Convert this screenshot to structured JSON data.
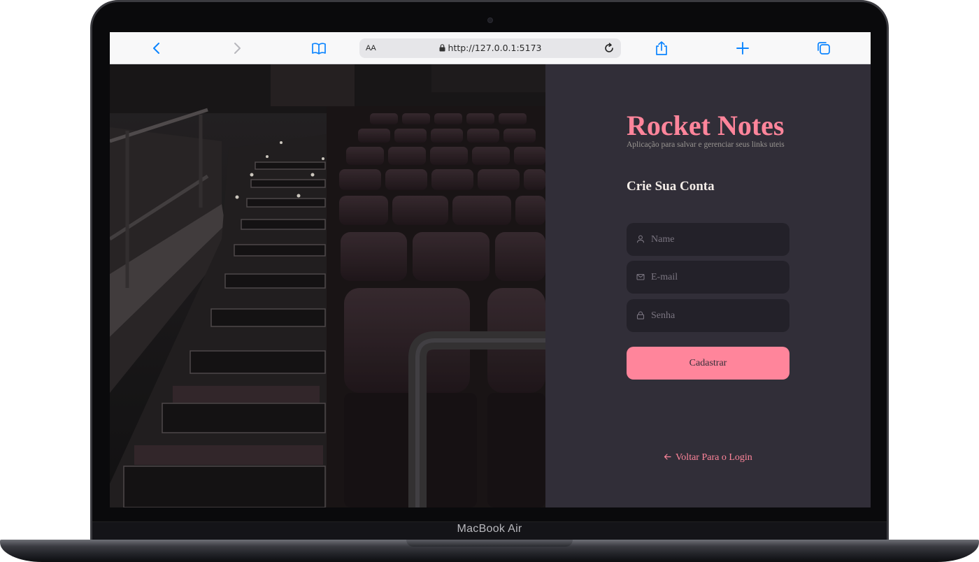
{
  "device": {
    "label": "MacBook Air"
  },
  "browser": {
    "text_size_label": "AA",
    "url": "http://127.0.0.1:5173"
  },
  "icons": {
    "back": "chevron-left-icon",
    "forward": "chevron-right-icon",
    "bookmarks": "book-icon",
    "lock": "lock-icon",
    "reload": "reload-icon",
    "share": "share-icon",
    "new_tab": "plus-icon",
    "tabs": "tabs-icon",
    "name_field": "user-icon",
    "email_field": "mail-icon",
    "password_field": "lock-icon",
    "back_link": "arrow-left-icon"
  },
  "page": {
    "app_title": "Rocket Notes",
    "app_subtitle": "Aplicação para salvar e gerenciar seus links uteis",
    "form_title": "Crie Sua Conta",
    "fields": {
      "name": {
        "placeholder": "Name",
        "value": ""
      },
      "email": {
        "placeholder": "E-mail",
        "value": ""
      },
      "password": {
        "placeholder": "Senha",
        "value": ""
      }
    },
    "submit_label": "Cadastrar",
    "back_link_label": "Voltar Para o Login"
  },
  "colors": {
    "accent": "#FF859B",
    "background": "#312E38",
    "input_background": "#232129",
    "text": "#F4EDE8",
    "muted_text": "#999591",
    "browser_accent": "#0A84FF"
  }
}
